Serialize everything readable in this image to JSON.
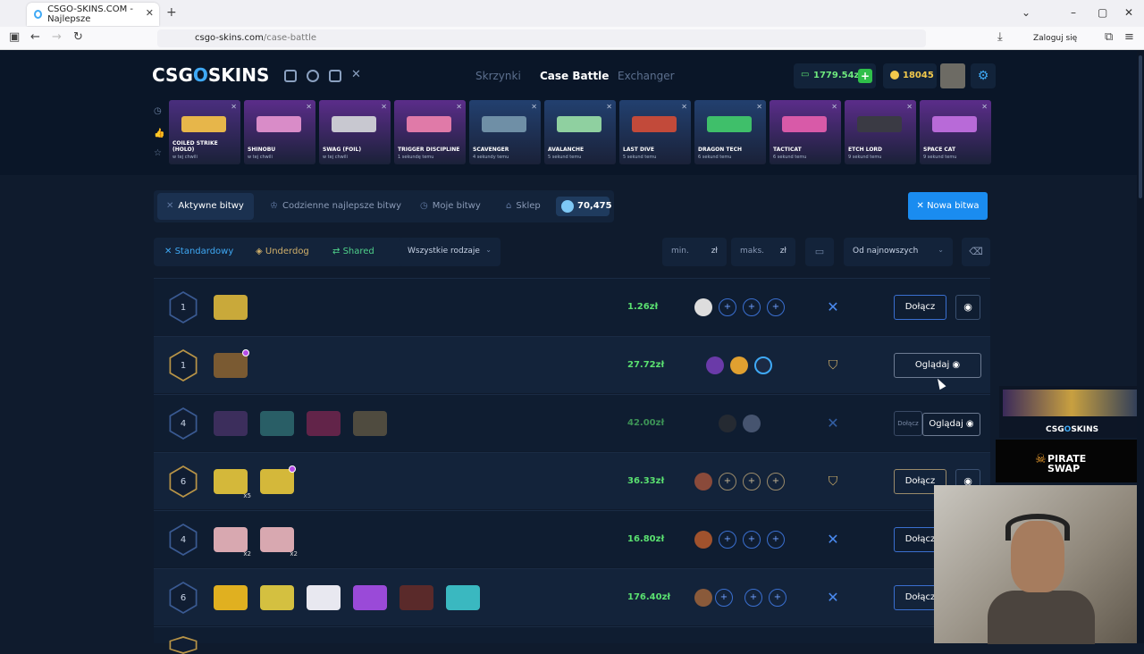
{
  "browser": {
    "tab_title": "CSGO-SKINS.COM - Najlepsze",
    "url_host": "csgo-skins.com",
    "url_path": "/case-battle",
    "login": "Zaloguj się"
  },
  "header": {
    "logo": [
      "CSG",
      "O",
      "SKINS"
    ],
    "nav": [
      "Skrzynki",
      "Case Battle",
      "Exchanger"
    ],
    "balance": "1779.54zł",
    "coins": "18045"
  },
  "drops": [
    {
      "name": "COILED STRIKE (HOLO)",
      "time": "w tej chwili",
      "bg": "#4a2e7e",
      "gun": "#e7b64a"
    },
    {
      "name": "SHINOBU",
      "time": "w tej chwili",
      "bg": "#5b2d8a",
      "gun": "#d98cc8"
    },
    {
      "name": "SWAG (FOIL)",
      "time": "w tej chwili",
      "bg": "#5b2d8a",
      "gun": "#c8c8d0"
    },
    {
      "name": "TRIGGER DISCIPLINE",
      "time": "1 sekundę temu",
      "bg": "#5b2d8a",
      "gun": "#e07aa8"
    },
    {
      "name": "SCAVENGER",
      "time": "4 sekundy temu",
      "bg": "#22406f",
      "gun": "#6f8fa6"
    },
    {
      "name": "AVALANCHE",
      "time": "5 sekund temu",
      "bg": "#22406f",
      "gun": "#8fd0a0"
    },
    {
      "name": "LAST DIVE",
      "time": "5 sekund temu",
      "bg": "#22406f",
      "gun": "#c24a3a"
    },
    {
      "name": "DRAGON TECH",
      "time": "6 sekund temu",
      "bg": "#22406f",
      "gun": "#3fbf6a"
    },
    {
      "name": "TACTICAT",
      "time": "6 sekund temu",
      "bg": "#5b2d8a",
      "gun": "#d85aa8"
    },
    {
      "name": "ETCH LORD",
      "time": "9 sekund temu",
      "bg": "#5b2d8a",
      "gun": "#3a3a44"
    },
    {
      "name": "SPACE CAT",
      "time": "9 sekund temu",
      "bg": "#5b2d8a",
      "gun": "#b86ad8"
    }
  ],
  "battle_tabs": [
    "Aktywne bitwy",
    "Codzienne najlepsze bitwy",
    "Moje bitwy",
    "Sklep"
  ],
  "gems": "70,475",
  "new_battle": "Nowa bitwa",
  "filters": {
    "modes": [
      "Standardowy",
      "Underdog",
      "Shared"
    ],
    "type_select": "Wszystkie rodzaje",
    "min": "min.",
    "max": "maks.",
    "currency": "zł",
    "sort": "Od najnowszych"
  },
  "rows": [
    {
      "rounds": "1",
      "price": "1.26zł",
      "mode": "standard",
      "action": "Dołącz"
    },
    {
      "rounds": "1",
      "price": "27.72zł",
      "mode": "underdog",
      "action": "Oglądaj"
    },
    {
      "rounds": "4",
      "price": "42.00zł",
      "mode": "standard",
      "action": "Oglądaj",
      "small": "Dołącz"
    },
    {
      "rounds": "6",
      "price": "36.33zł",
      "mode": "underdog",
      "action": "Dołącz",
      "mult": "x5"
    },
    {
      "rounds": "4",
      "price": "16.80zł",
      "mode": "standard",
      "action": "Dołącz",
      "mult": "x2",
      "mult2": "x2"
    },
    {
      "rounds": "6",
      "price": "176.40zł",
      "mode": "standard",
      "action": "Dołącz"
    }
  ],
  "overlay": {
    "logo": [
      "CSG",
      "O",
      "SKINS"
    ],
    "sponsor": [
      "PIRATE",
      "SWAP"
    ]
  },
  "colors": {
    "accent": "#1a8cf0",
    "price": "#5ae070",
    "gold": "#b89447"
  }
}
